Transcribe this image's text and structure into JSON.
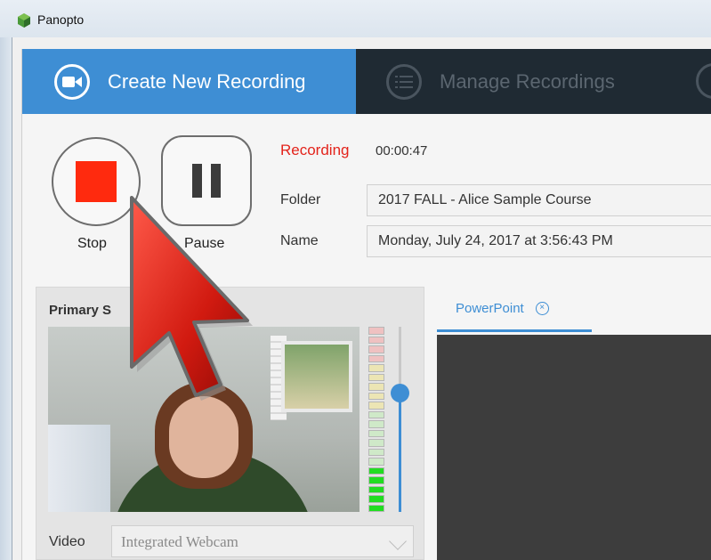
{
  "window": {
    "title": "Panopto"
  },
  "tabs": {
    "create": "Create New Recording",
    "manage": "Manage Recordings"
  },
  "controls": {
    "stop_label": "Stop",
    "pause_label": "Pause"
  },
  "status": {
    "label": "Recording",
    "time": "00:00:47"
  },
  "fields": {
    "folder_label": "Folder",
    "folder_value": "2017 FALL - Alice Sample Course",
    "name_label": "Name",
    "name_value": "Monday, July 24, 2017 at 3:56:43 PM"
  },
  "primary_source": {
    "title": "Primary S",
    "video_label": "Video",
    "video_value": "Integrated Webcam"
  },
  "powerpoint": {
    "tab_label": "PowerPoint"
  },
  "colors": {
    "accent": "#3e8ed4",
    "recording": "#e3231b",
    "stop": "#ff2a0e",
    "tab_bar": "#1f2a33"
  },
  "audio_meter": {
    "level_segments_on": 5,
    "total_segments": 20
  }
}
